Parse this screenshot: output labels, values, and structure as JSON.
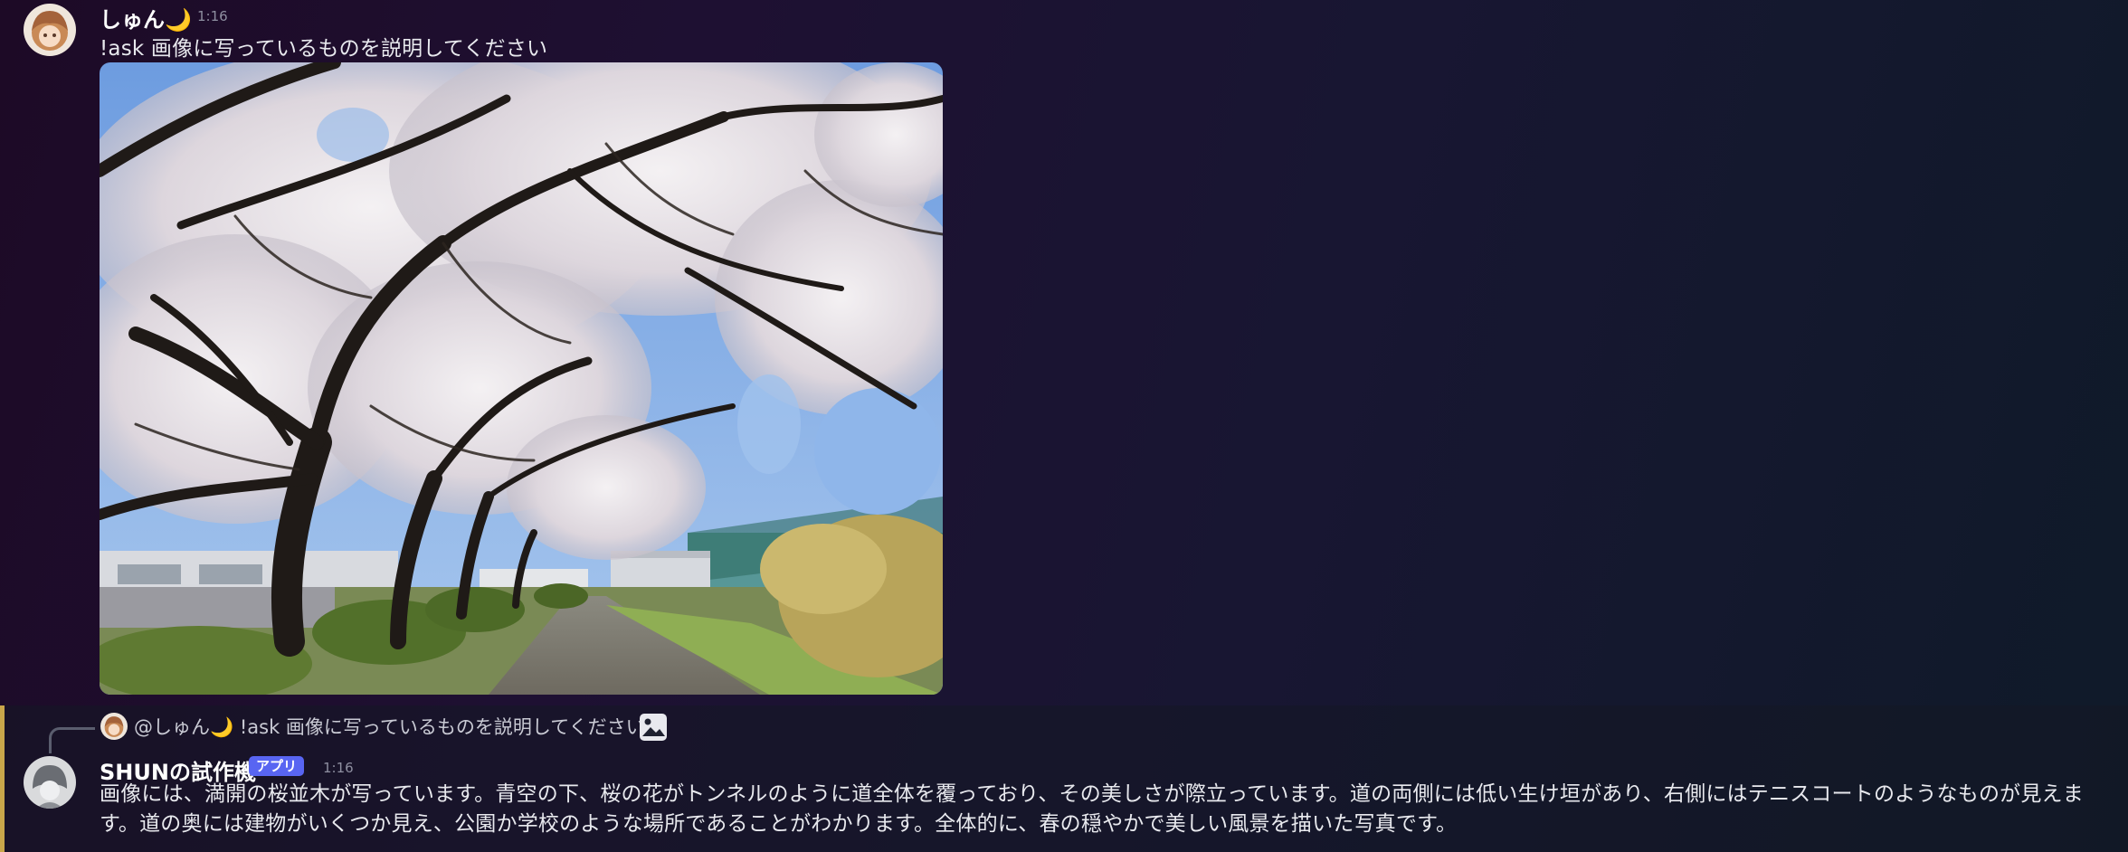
{
  "messages": [
    {
      "author": "しゅん🌙",
      "time": "1:16",
      "content": "!ask 画像に写っているものを説明してください",
      "attachment": {
        "kind": "photo",
        "subject": "cherry-blossom-path"
      }
    },
    {
      "reply_preview": {
        "mention": "@しゅん🌙",
        "content": "!ask 画像に写っているものを説明してください",
        "icon": "image-icon"
      },
      "author": "SHUNの試作機",
      "badge": "アプリ",
      "time": "1:16",
      "content": "画像には、満開の桜並木が写っています。青空の下、桜の花がトンネルのように道全体を覆っており、その美しさが際立っています。道の両側には低い生け垣があり、右側にはテニスコートのようなものが見えます。道の奥には建物がいくつか見え、公園か学校のような場所であることがわかります。全体的に、春の穏やかで美しい風景を描いた写真です。"
    }
  ],
  "colors": {
    "badge": "#5865f2",
    "reply_accent": "#c9a64a",
    "timestamp": "#8e8fa0"
  }
}
